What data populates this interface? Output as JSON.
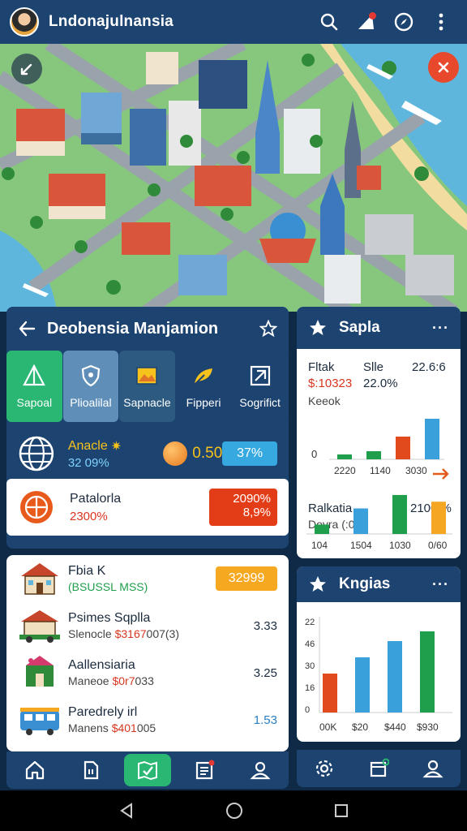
{
  "app": {
    "title": "Lndonajulnansia"
  },
  "map_controls": {
    "locate": "locate-icon",
    "close": "close-icon"
  },
  "main_panel": {
    "title": "Deobensia Manjamion",
    "tabs": [
      {
        "label": "Sapoal",
        "icon": "tent-icon"
      },
      {
        "label": "Plioalilal",
        "icon": "shield-icon"
      },
      {
        "label": "Sapnacle",
        "icon": "picture-icon"
      },
      {
        "label": "Fipperi",
        "icon": "leaf-icon"
      },
      {
        "label": "Sogrifict",
        "icon": "map-icon"
      }
    ],
    "stat": {
      "label": "Anacle",
      "sub": "32 09%",
      "coin_value": "0.50",
      "badge": "37%"
    },
    "summary": {
      "title": "Patalorla",
      "sub": "2300%",
      "badge_top": "2090%",
      "badge_bottom": "8,9%"
    },
    "list": [
      {
        "title": "Fbia K",
        "sub": "(BSUSSL MSS)",
        "badge": "32999"
      },
      {
        "title": "Psimes Sqplla",
        "sub_prefix": "Slenocle",
        "sub_value": "$3167",
        "sub_suffix": "007(3)",
        "value": "3.33"
      },
      {
        "title": "Aallensiaria",
        "sub_prefix": "Maneoe",
        "sub_value": "$0r7",
        "sub_suffix": "033",
        "value": "3.25"
      },
      {
        "title": "Paredrely irl",
        "sub_prefix": "Manens",
        "sub_value": "$401",
        "sub_suffix": "005",
        "value": "1.53"
      }
    ]
  },
  "panel_sapla": {
    "title": "Sapla",
    "chart1": {
      "col1_label": "Fltak",
      "col1_value": "$:10323",
      "col1_sub": "Keeok",
      "col2_label": "Slle",
      "col2_value": "22.0%",
      "col3_value": "22.6:6"
    },
    "chart2": {
      "label": "Ralkatia",
      "sub": "Dovra (:08)",
      "value": "2100 %"
    }
  },
  "panel_kngias": {
    "title": "Kngias"
  },
  "chart_data": [
    {
      "type": "bar",
      "title": "",
      "categories": [
        "2220",
        "1140",
        "3030"
      ],
      "values": [
        6,
        10,
        28,
        50
      ],
      "y_tick": "0",
      "ylim": [
        0,
        60
      ]
    },
    {
      "type": "bar",
      "title": "",
      "categories": [
        "104",
        "1504",
        "1030",
        "0/60"
      ],
      "values": [
        14,
        38,
        58,
        48
      ],
      "ylim": [
        0,
        70
      ]
    },
    {
      "type": "bar",
      "title": "",
      "categories": [
        "00K",
        "$20",
        "$440",
        "$930"
      ],
      "y_ticks": [
        "22",
        "46",
        "30",
        "16",
        "0"
      ],
      "values": [
        24,
        34,
        44,
        50
      ],
      "ylim": [
        0,
        55
      ]
    }
  ],
  "colors": {
    "primary": "#1d4370",
    "accent_green": "#2ab673",
    "accent_orange": "#e25a1c",
    "accent_yellow": "#f6a821",
    "accent_blue": "#35a9e0",
    "bar_green": "#1f9e4c",
    "bar_red": "#e04a1c",
    "bar_blue": "#3aa0dc",
    "bar_orange": "#f5a623"
  },
  "bottom_nav_left": [
    "home-icon",
    "document-icon",
    "map-check-icon",
    "list-icon",
    "profile-icon"
  ],
  "bottom_nav_right": [
    "settings-icon",
    "window-icon",
    "profile-icon"
  ]
}
